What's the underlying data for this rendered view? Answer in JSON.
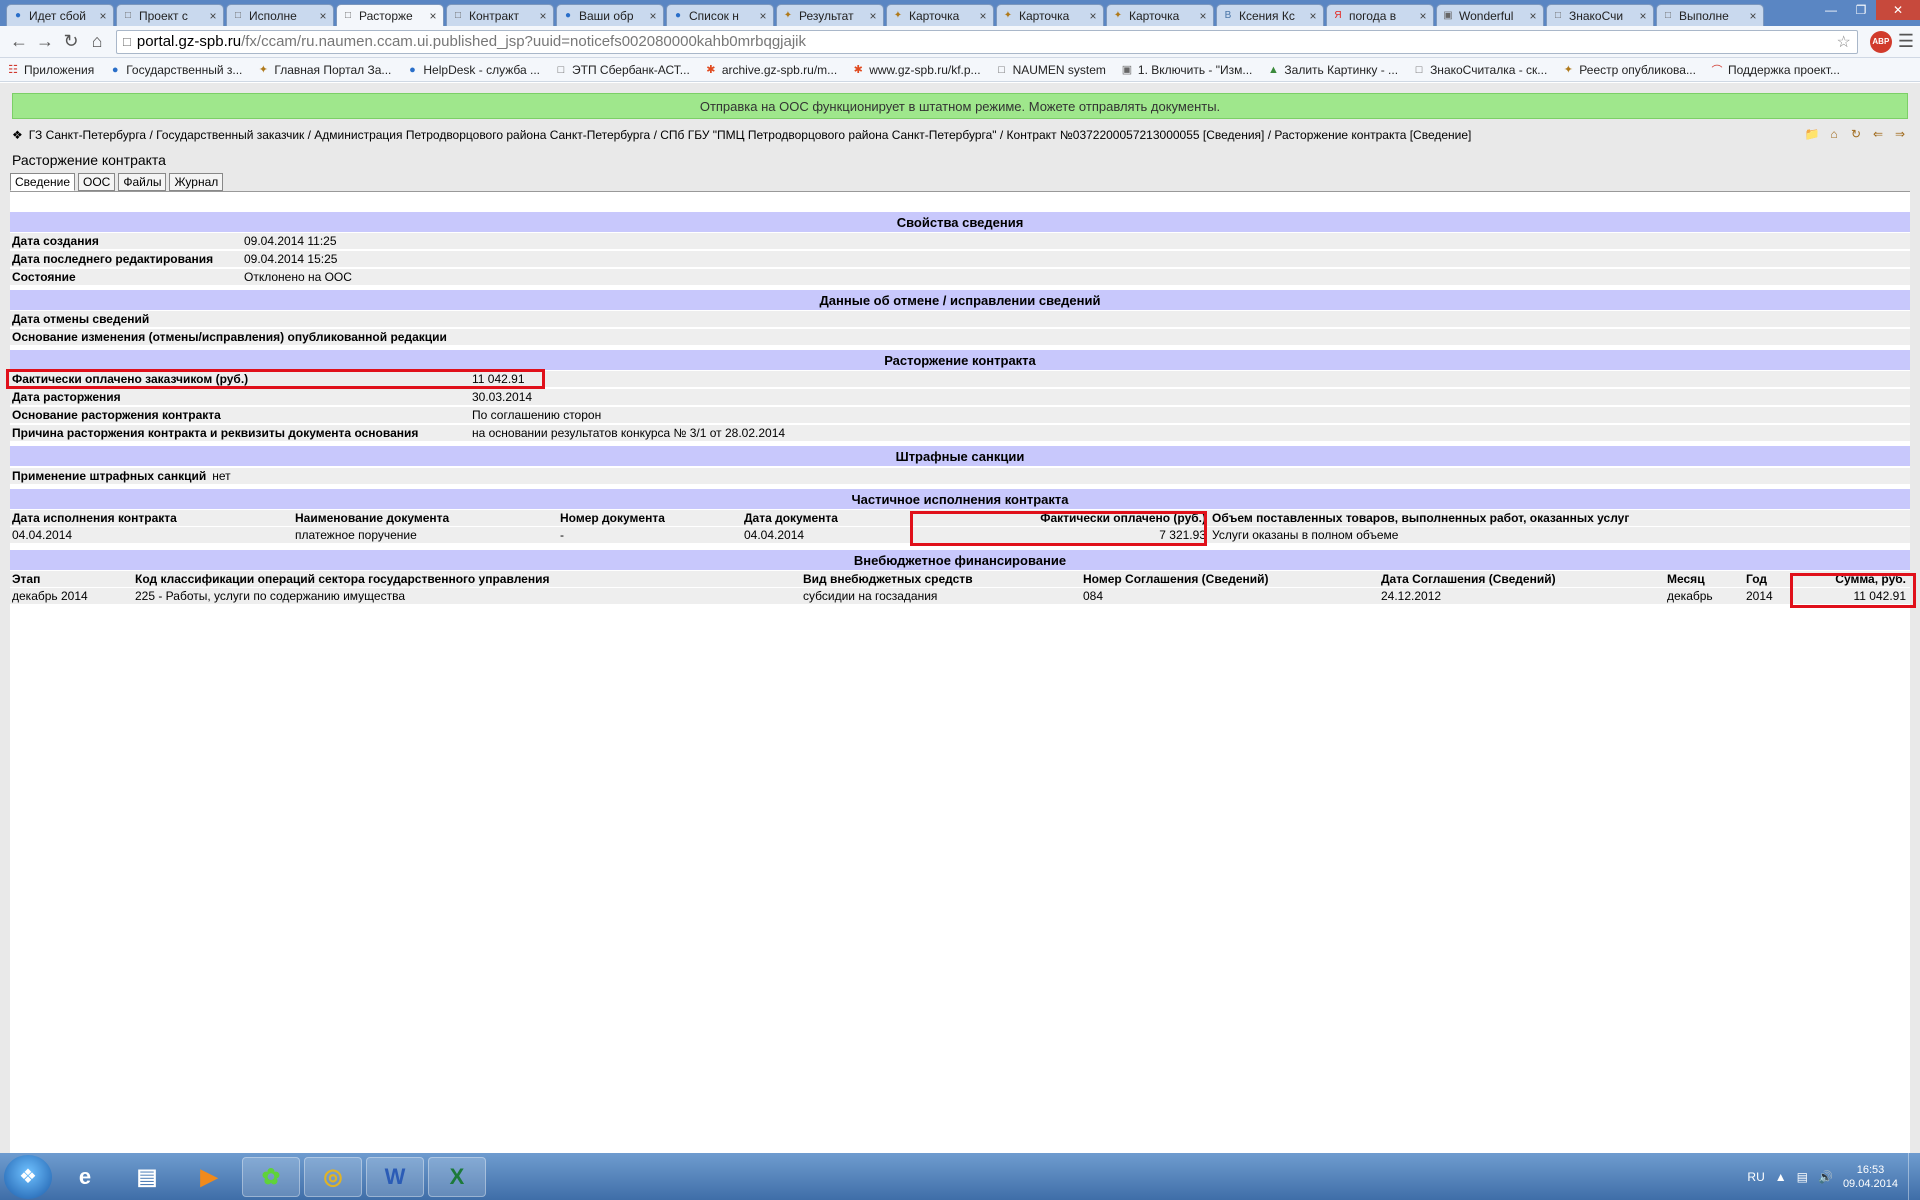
{
  "browser": {
    "tabs": [
      {
        "title": "Идет сбой",
        "icon": "globe-icon",
        "active": false
      },
      {
        "title": "Проект с",
        "icon": "doc-icon",
        "active": false
      },
      {
        "title": "Исполне",
        "icon": "doc-icon",
        "active": false
      },
      {
        "title": "Расторже",
        "icon": "doc-icon",
        "active": true
      },
      {
        "title": "Контракт",
        "icon": "doc-icon",
        "active": false
      },
      {
        "title": "Ваши обр",
        "icon": "globe-icon",
        "active": false
      },
      {
        "title": "Список н",
        "icon": "globe-icon",
        "active": false
      },
      {
        "title": "Результат",
        "icon": "emblem-icon",
        "active": false
      },
      {
        "title": "Карточка",
        "icon": "emblem-icon",
        "active": false
      },
      {
        "title": "Карточка",
        "icon": "emblem-icon",
        "active": false
      },
      {
        "title": "Карточка",
        "icon": "emblem-icon",
        "active": false
      },
      {
        "title": "Ксения Кс",
        "icon": "vk-icon",
        "active": false
      },
      {
        "title": "погода в",
        "icon": "yandex-icon",
        "active": false
      },
      {
        "title": "Wonderful",
        "icon": "app-icon",
        "active": false
      },
      {
        "title": "ЗнакоСчи",
        "icon": "doc-icon",
        "active": false
      },
      {
        "title": "Выполне",
        "icon": "doc-icon",
        "active": false
      }
    ],
    "url_host": "portal.gz-spb.ru",
    "url_path": "/fx/ccam/ru.naumen.ccam.ui.published_jsp?uuid=noticefs002080000kahb0mrbqgjajik",
    "abp_label": "ABP",
    "bookmarks": [
      {
        "label": "Приложения",
        "icon": "apps-icon"
      },
      {
        "label": "Государственный з...",
        "icon": "globe-icon"
      },
      {
        "label": "Главная Портал За...",
        "icon": "emblem-icon"
      },
      {
        "label": "HelpDesk - служба ...",
        "icon": "globe-icon"
      },
      {
        "label": "ЭТП Сбербанк-АСТ...",
        "icon": "doc-icon"
      },
      {
        "label": "archive.gz-spb.ru/m...",
        "icon": "asterisk-icon"
      },
      {
        "label": "www.gz-spb.ru/kf.p...",
        "icon": "asterisk-icon"
      },
      {
        "label": "NAUMEN system",
        "icon": "doc-icon"
      },
      {
        "label": "1. Включить - \"Изм...",
        "icon": "app-icon"
      },
      {
        "label": "Залить Картинку - ...",
        "icon": "image-icon"
      },
      {
        "label": "ЗнакоСчиталка - ск...",
        "icon": "doc-icon"
      },
      {
        "label": "Реестр опубликова...",
        "icon": "emblem-icon"
      },
      {
        "label": "Поддержка проект...",
        "icon": "arc-icon"
      }
    ]
  },
  "page": {
    "banner": "Отправка на ООС функционирует в штатном режиме. Можете отправлять документы.",
    "breadcrumb": "ГЗ Санкт-Петербурга / Государственный заказчик / Администрация Петродворцового района Санкт-Петербурга / СПб ГБУ \"ПМЦ Петродворцового района Санкт-Петербурга\" / Контракт №0372200057213000055 [Сведения] / Расторжение контракта [Сведение]",
    "title": "Расторжение контракта",
    "tabs": [
      "Сведение",
      "ООС",
      "Файлы",
      "Журнал"
    ],
    "sections": {
      "props": {
        "title": "Свойства сведения",
        "rows": [
          {
            "label": "Дата создания",
            "value": "09.04.2014 11:25"
          },
          {
            "label": "Дата последнего редактирования",
            "value": "09.04.2014 15:25"
          },
          {
            "label": "Состояние",
            "value": "Отклонено на ООС"
          }
        ]
      },
      "cancel": {
        "title": "Данные об отмене / исправлении сведений",
        "rows": [
          {
            "label": "Дата отмены сведений",
            "value": ""
          },
          {
            "label": "Основание изменения (отмены/исправления) опубликованной редакции",
            "value": ""
          }
        ]
      },
      "termination": {
        "title": "Расторжение контракта",
        "rows": [
          {
            "label": "Фактически оплачено заказчиком (руб.)",
            "value": "11 042.91"
          },
          {
            "label": "Дата расторжения",
            "value": "30.03.2014"
          },
          {
            "label": "Основание расторжения контракта",
            "value": "По соглашению сторон"
          },
          {
            "label": "Причина расторжения контракта и реквизиты документа основания",
            "value": "на основании результатов конкурса № 3/1 от 28.02.2014"
          }
        ]
      },
      "penalties": {
        "title": "Штрафные санкции",
        "rows": [
          {
            "label": "Применение штрафных санкций",
            "value": "нет"
          }
        ]
      },
      "partial": {
        "title": "Частичное исполнения контракта",
        "headers": [
          "Дата исполнения контракта",
          "Наименование документа",
          "Номер документа",
          "Дата документа",
          "Фактически оплачено (руб.)",
          "Объем поставленных товаров, выполненных работ, оказанных услуг"
        ],
        "rows": [
          [
            "04.04.2014",
            "платежное поручение",
            "-",
            "04.04.2014",
            "7 321.93",
            "Услуги оказаны в полном объеме"
          ]
        ]
      },
      "funding": {
        "title": "Внебюджетное финансирование",
        "headers": [
          "Этап",
          "Код классификации операций сектора государственного управления",
          "Вид внебюджетных средств",
          "Номер Соглашения (Сведений)",
          "Дата Соглашения (Сведений)",
          "Месяц",
          "Год",
          "Сумма, руб."
        ],
        "rows": [
          [
            "декабрь 2014",
            "225 - Работы, услуги по содержанию имущества",
            "субсидии на госзадания",
            "084",
            "24.12.2012",
            "декабрь",
            "2014",
            "11 042.91"
          ]
        ]
      }
    }
  },
  "taskbar": {
    "apps": [
      {
        "name": "ie-icon",
        "pinned": false
      },
      {
        "name": "explorer-icon",
        "pinned": false
      },
      {
        "name": "media-player-icon",
        "pinned": false
      },
      {
        "name": "icq-icon",
        "pinned": true
      },
      {
        "name": "chrome-icon",
        "pinned": true
      },
      {
        "name": "word-icon",
        "pinned": true
      },
      {
        "name": "excel-icon",
        "pinned": true
      }
    ],
    "lang": "RU",
    "time": "16:53",
    "date": "09.04.2014"
  }
}
